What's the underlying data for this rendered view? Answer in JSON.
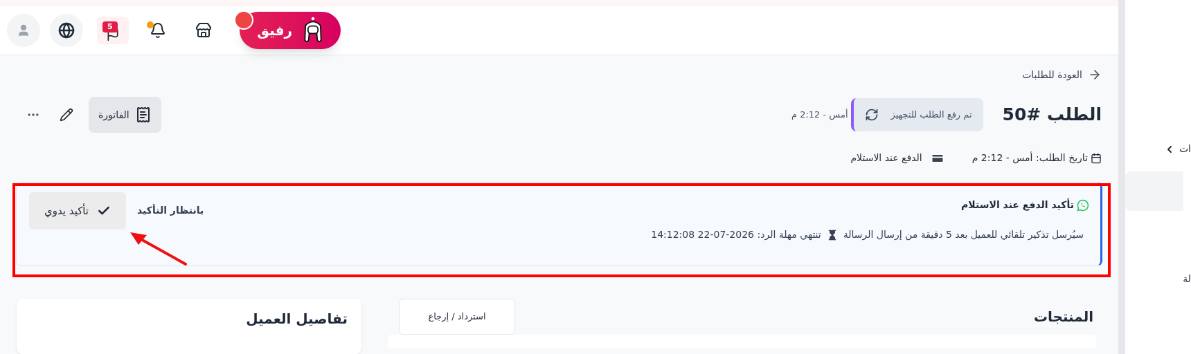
{
  "top_bar": {
    "assistant": {
      "label": "رفيق",
      "alert": true
    },
    "messages_badge": "5",
    "bell_alert": true
  },
  "back_link": "العودة للطلبات",
  "order": {
    "title": "الطلب #50",
    "status": "تم رفع الطلب للتجهيز",
    "status_time": "أمس - 2:12 م",
    "invoice_button": "الفاتورة",
    "date": "تاريخ الطلب: أمس - 2:12 م",
    "payment": "الدفع عند الاستلام"
  },
  "confirmation": {
    "title": "تأكيد الدفع عند الاستلام",
    "state": "بانتظار التأكيد",
    "note": "سيُرسل تذكير تلقائي للعميل بعد 5 دقيقة من إرسال الرسالة",
    "deadline": "تنتهي مهلة الرد: 2026-07-22 14:12:08",
    "button": "تأكيد يدوي"
  },
  "sections": {
    "products": "المنتجات",
    "refund_button": "استرداد / إرجاع",
    "customer": "تفاصيل العميل"
  },
  "sidebar": {
    "items": [
      {
        "label": "ات"
      },
      {
        "label": "لة"
      }
    ]
  }
}
